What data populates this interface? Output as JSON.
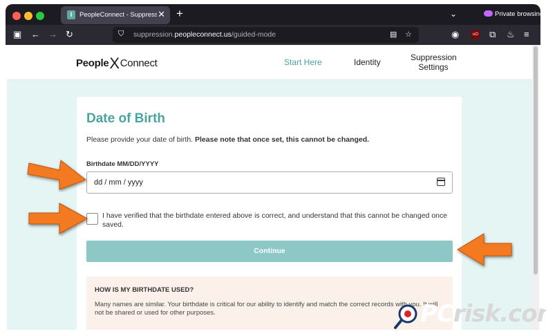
{
  "browser": {
    "tab_title": "PeopleConnect - Suppression C",
    "tab_favicon_letter": "I",
    "tab_close": "✕",
    "new_tab": "+",
    "private_label": "Private browsing",
    "url_prefix": "suppression.",
    "url_domain": "peopleconnect.us",
    "url_path": "/guided-mode"
  },
  "site": {
    "logo_people": "People",
    "logo_x": "X",
    "logo_connect": "Connect",
    "nav": {
      "start_here": "Start Here",
      "identity": "Identity",
      "suppression_settings": "Suppression Settings"
    }
  },
  "form": {
    "title": "Date of Birth",
    "description": "Please provide your date of birth.",
    "description_bold": "Please note that once set, this cannot be changed.",
    "birthdate_label": "Birthdate MM/DD/YYYY",
    "birthdate_placeholder": "dd / mm / yyyy",
    "verify_label": "I have verified that the birthdate entered above is correct, and understand that this cannot be changed once saved.",
    "continue_label": "Continue",
    "info_title": "HOW IS MY BIRTHDATE USED?",
    "info_text": "Many names are similar. Your birthdate is critical for our ability to identify and match the correct records with you. It will not be shared or used for other purposes."
  },
  "watermark": {
    "pc": "PC",
    "risk": "risk.com"
  },
  "colors": {
    "accent": "#4aa3a0",
    "button_disabled": "#8dc8c6",
    "page_bg": "#e4f5f4",
    "info_bg": "#fbf1ea",
    "arrow": "#f47a20"
  }
}
